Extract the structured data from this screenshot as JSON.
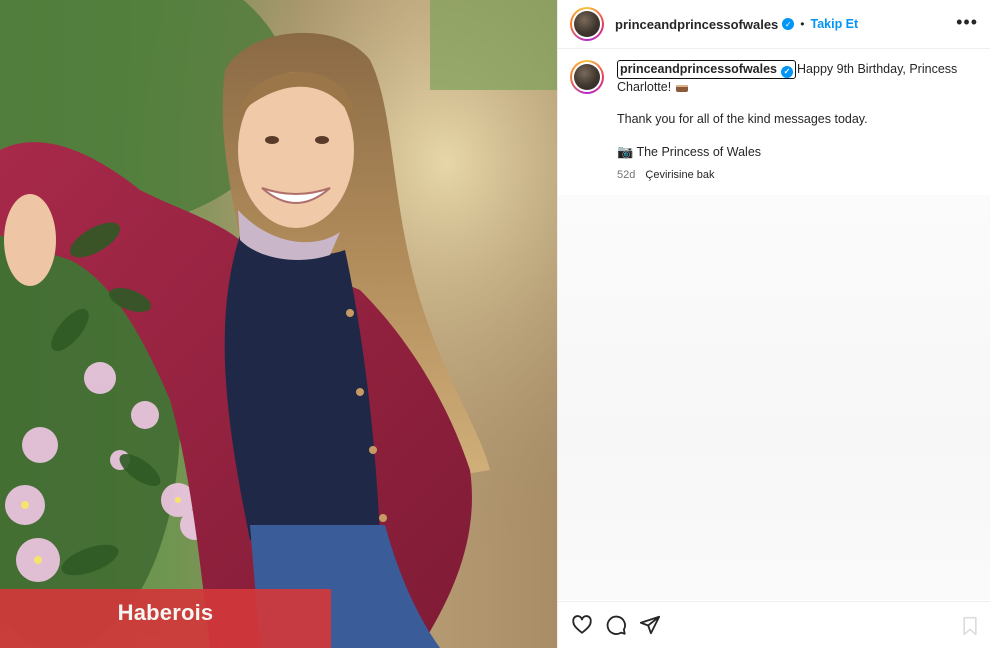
{
  "watermark": {
    "label": "Haberois"
  },
  "post": {
    "username": "princeandprincessofwales",
    "verified_icon": "verified-badge-icon",
    "separator": "•",
    "follow_label": "Takip Et",
    "more_icon": "more-options-icon",
    "caption": {
      "username": "princeandprincessofwales",
      "text_1": "Happy 9th Birthday, Princess Charlotte!",
      "text_2": "Thank you for all of the kind messages today.",
      "credit": "The Princess of Wales",
      "credit_icon": "camera-icon",
      "age": "52d",
      "translate_label": "Çevirisine bak"
    },
    "actions": [
      "heart-icon",
      "comment-icon",
      "share-icon",
      "bookmark-icon"
    ],
    "accent_color": "#0095f6"
  }
}
